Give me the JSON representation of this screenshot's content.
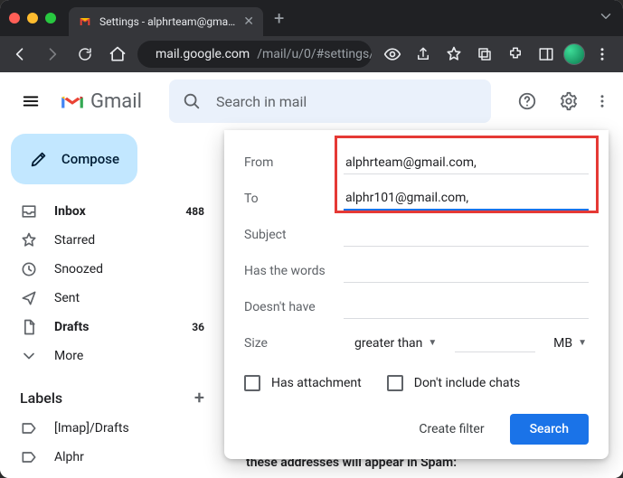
{
  "browser": {
    "tab_title": "Settings - alphrteam@gmail.co",
    "url_host": "mail.google.com",
    "url_path": "/mail/u/0/#settings/fi..."
  },
  "header": {
    "product": "Gmail",
    "search_placeholder": "Search in mail"
  },
  "compose_label": "Compose",
  "nav": [
    {
      "icon": "inbox",
      "label": "Inbox",
      "count": "488",
      "bold": true
    },
    {
      "icon": "star",
      "label": "Starred",
      "count": "",
      "bold": false
    },
    {
      "icon": "clock",
      "label": "Snoozed",
      "count": "",
      "bold": false
    },
    {
      "icon": "send",
      "label": "Sent",
      "count": "",
      "bold": false
    },
    {
      "icon": "file",
      "label": "Drafts",
      "count": "36",
      "bold": true
    },
    {
      "icon": "chevron-down",
      "label": "More",
      "count": "",
      "bold": false
    }
  ],
  "labels_header": "Labels",
  "labels": [
    {
      "label": "[Imap]/Drafts"
    },
    {
      "label": "Alphr"
    }
  ],
  "filter": {
    "from_label": "From",
    "from_value": "alphrteam@gmail.com,",
    "to_label": "To",
    "to_value": "alphr101@gmail.com,",
    "subject_label": "Subject",
    "has_words_label": "Has the words",
    "doesnt_have_label": "Doesn't have",
    "size_label": "Size",
    "size_op": "greater than",
    "size_unit": "MB",
    "has_attachment": "Has attachment",
    "no_chats": "Don't include chats",
    "create_filter": "Create filter",
    "search": "Search"
  },
  "main_cut_text": "these addresses will appear in Spam:"
}
